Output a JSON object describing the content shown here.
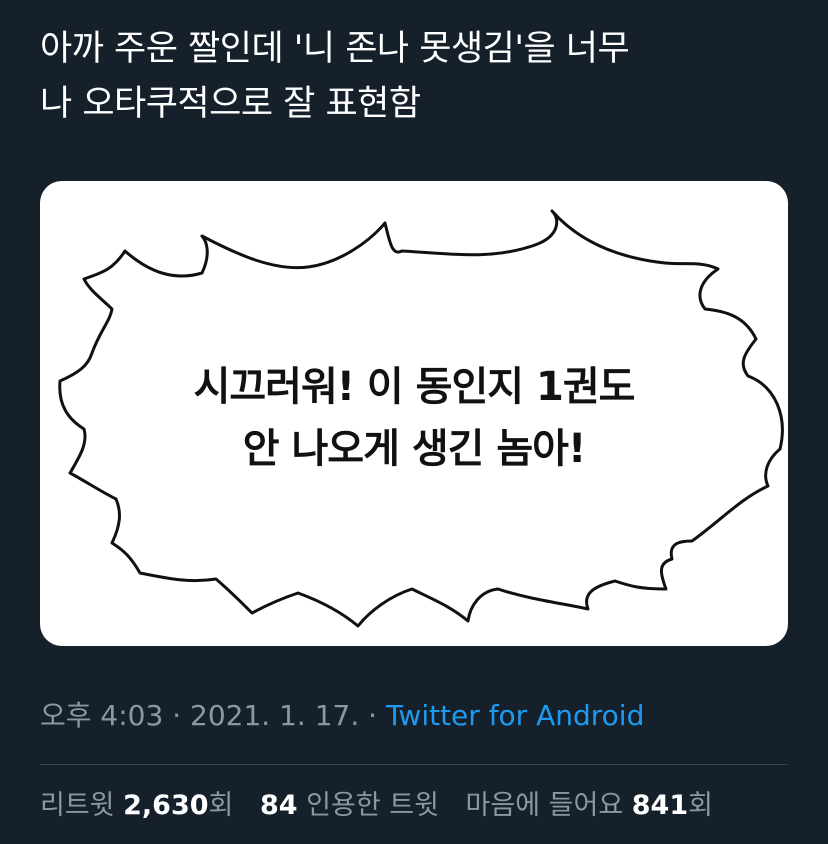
{
  "tweet": {
    "text_line1": "아까 주운 짤인데 '니 존나 못생김'을 너무",
    "text_line2": "나 오타쿠적으로 잘 표현함"
  },
  "media": {
    "bubble_line1": "시끄러워! 이 동인지 1권도",
    "bubble_line2": "안 나오게 생긴 놈아!"
  },
  "meta": {
    "time": "오후 4:03",
    "separator": "·",
    "date": "2021. 1. 17.",
    "source": "Twitter for Android"
  },
  "stats": {
    "retweet_label": "리트윗",
    "retweet_count": "2,630",
    "retweet_unit": "회",
    "quote_count": "84",
    "quote_label": "인용한 트윗",
    "like_label": "마음에 들어요",
    "like_count": "841",
    "like_unit": "회"
  },
  "colors": {
    "background": "#15202b",
    "secondary_text": "#8899a6",
    "link": "#1d9bf0"
  }
}
